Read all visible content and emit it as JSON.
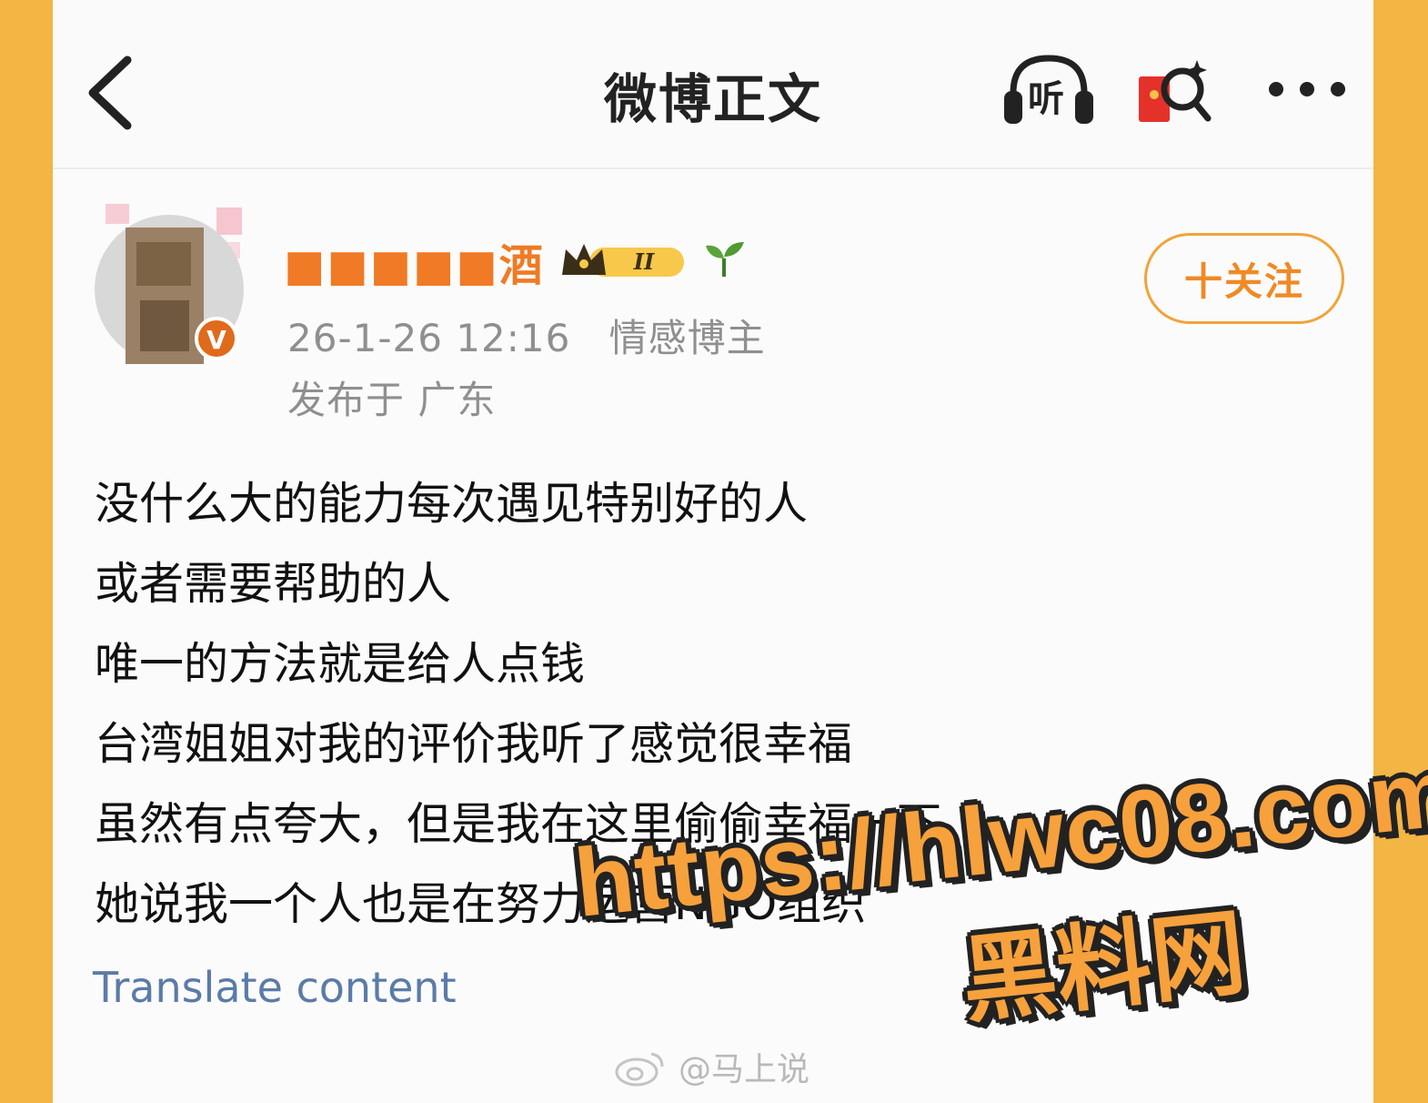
{
  "nav": {
    "title": "微博正文",
    "back_icon": "chevron-left-icon",
    "listen_label": "听",
    "listen_icon": "headphones-icon",
    "redpacket_icon": "red-packet-icon",
    "more_icon": "more-dots-icon"
  },
  "post": {
    "author_name": "■■■■■酒",
    "level_badge": "II",
    "timestamp": "26-1-26 12:16",
    "author_type": "情感博主",
    "location": "发布于 广东",
    "follow_label": "十关注",
    "content_lines": [
      "没什么大的能力每次遇见特别好的人",
      "或者需要帮助的人",
      "唯一的方法就是给人点钱",
      "台湾姐姐对我的评价我听了感觉很幸福",
      "虽然有点夸大，但是我在这里偷偷幸福一下",
      "她说我一个人也是在努力运营NGO组织"
    ],
    "translate_label": "Translate content"
  },
  "footer_watermark": {
    "text": "@马上说",
    "icon": "weibo-logo-icon"
  },
  "overlay": {
    "url": "https://hlwc08.com",
    "cn_text": "黑料网"
  },
  "colors": {
    "background_frame": "#f3b544",
    "accent_orange": "#f08a24",
    "translate_blue": "#5b7ba8",
    "meta_gray": "#8f8f8f"
  }
}
